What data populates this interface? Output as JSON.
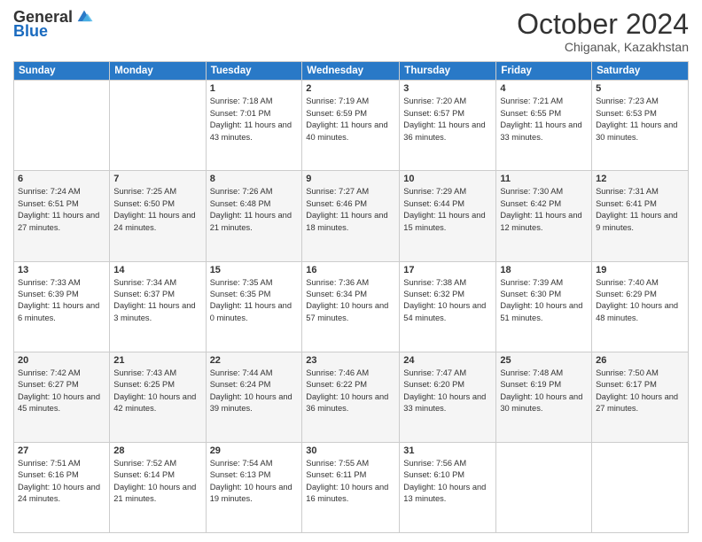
{
  "logo": {
    "general": "General",
    "blue": "Blue"
  },
  "title": "October 2024",
  "subtitle": "Chiganak, Kazakhstan",
  "headers": [
    "Sunday",
    "Monday",
    "Tuesday",
    "Wednesday",
    "Thursday",
    "Friday",
    "Saturday"
  ],
  "weeks": [
    [
      {
        "day": "",
        "info": ""
      },
      {
        "day": "",
        "info": ""
      },
      {
        "day": "1",
        "info": "Sunrise: 7:18 AM\nSunset: 7:01 PM\nDaylight: 11 hours and 43 minutes."
      },
      {
        "day": "2",
        "info": "Sunrise: 7:19 AM\nSunset: 6:59 PM\nDaylight: 11 hours and 40 minutes."
      },
      {
        "day": "3",
        "info": "Sunrise: 7:20 AM\nSunset: 6:57 PM\nDaylight: 11 hours and 36 minutes."
      },
      {
        "day": "4",
        "info": "Sunrise: 7:21 AM\nSunset: 6:55 PM\nDaylight: 11 hours and 33 minutes."
      },
      {
        "day": "5",
        "info": "Sunrise: 7:23 AM\nSunset: 6:53 PM\nDaylight: 11 hours and 30 minutes."
      }
    ],
    [
      {
        "day": "6",
        "info": "Sunrise: 7:24 AM\nSunset: 6:51 PM\nDaylight: 11 hours and 27 minutes."
      },
      {
        "day": "7",
        "info": "Sunrise: 7:25 AM\nSunset: 6:50 PM\nDaylight: 11 hours and 24 minutes."
      },
      {
        "day": "8",
        "info": "Sunrise: 7:26 AM\nSunset: 6:48 PM\nDaylight: 11 hours and 21 minutes."
      },
      {
        "day": "9",
        "info": "Sunrise: 7:27 AM\nSunset: 6:46 PM\nDaylight: 11 hours and 18 minutes."
      },
      {
        "day": "10",
        "info": "Sunrise: 7:29 AM\nSunset: 6:44 PM\nDaylight: 11 hours and 15 minutes."
      },
      {
        "day": "11",
        "info": "Sunrise: 7:30 AM\nSunset: 6:42 PM\nDaylight: 11 hours and 12 minutes."
      },
      {
        "day": "12",
        "info": "Sunrise: 7:31 AM\nSunset: 6:41 PM\nDaylight: 11 hours and 9 minutes."
      }
    ],
    [
      {
        "day": "13",
        "info": "Sunrise: 7:33 AM\nSunset: 6:39 PM\nDaylight: 11 hours and 6 minutes."
      },
      {
        "day": "14",
        "info": "Sunrise: 7:34 AM\nSunset: 6:37 PM\nDaylight: 11 hours and 3 minutes."
      },
      {
        "day": "15",
        "info": "Sunrise: 7:35 AM\nSunset: 6:35 PM\nDaylight: 11 hours and 0 minutes."
      },
      {
        "day": "16",
        "info": "Sunrise: 7:36 AM\nSunset: 6:34 PM\nDaylight: 10 hours and 57 minutes."
      },
      {
        "day": "17",
        "info": "Sunrise: 7:38 AM\nSunset: 6:32 PM\nDaylight: 10 hours and 54 minutes."
      },
      {
        "day": "18",
        "info": "Sunrise: 7:39 AM\nSunset: 6:30 PM\nDaylight: 10 hours and 51 minutes."
      },
      {
        "day": "19",
        "info": "Sunrise: 7:40 AM\nSunset: 6:29 PM\nDaylight: 10 hours and 48 minutes."
      }
    ],
    [
      {
        "day": "20",
        "info": "Sunrise: 7:42 AM\nSunset: 6:27 PM\nDaylight: 10 hours and 45 minutes."
      },
      {
        "day": "21",
        "info": "Sunrise: 7:43 AM\nSunset: 6:25 PM\nDaylight: 10 hours and 42 minutes."
      },
      {
        "day": "22",
        "info": "Sunrise: 7:44 AM\nSunset: 6:24 PM\nDaylight: 10 hours and 39 minutes."
      },
      {
        "day": "23",
        "info": "Sunrise: 7:46 AM\nSunset: 6:22 PM\nDaylight: 10 hours and 36 minutes."
      },
      {
        "day": "24",
        "info": "Sunrise: 7:47 AM\nSunset: 6:20 PM\nDaylight: 10 hours and 33 minutes."
      },
      {
        "day": "25",
        "info": "Sunrise: 7:48 AM\nSunset: 6:19 PM\nDaylight: 10 hours and 30 minutes."
      },
      {
        "day": "26",
        "info": "Sunrise: 7:50 AM\nSunset: 6:17 PM\nDaylight: 10 hours and 27 minutes."
      }
    ],
    [
      {
        "day": "27",
        "info": "Sunrise: 7:51 AM\nSunset: 6:16 PM\nDaylight: 10 hours and 24 minutes."
      },
      {
        "day": "28",
        "info": "Sunrise: 7:52 AM\nSunset: 6:14 PM\nDaylight: 10 hours and 21 minutes."
      },
      {
        "day": "29",
        "info": "Sunrise: 7:54 AM\nSunset: 6:13 PM\nDaylight: 10 hours and 19 minutes."
      },
      {
        "day": "30",
        "info": "Sunrise: 7:55 AM\nSunset: 6:11 PM\nDaylight: 10 hours and 16 minutes."
      },
      {
        "day": "31",
        "info": "Sunrise: 7:56 AM\nSunset: 6:10 PM\nDaylight: 10 hours and 13 minutes."
      },
      {
        "day": "",
        "info": ""
      },
      {
        "day": "",
        "info": ""
      }
    ]
  ]
}
